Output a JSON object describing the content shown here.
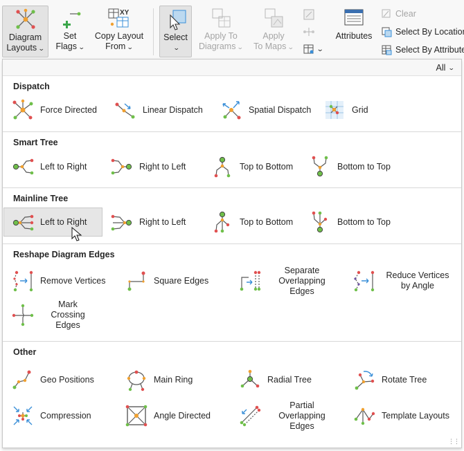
{
  "ribbon": {
    "diagram_layouts": {
      "line1": "Diagram",
      "line2": "Layouts",
      "icon": "diagram-layouts-icon"
    },
    "set_flags": {
      "line1": "Set",
      "line2": "Flags",
      "icon": "set-flags-icon"
    },
    "copy_layout": {
      "line1": "Copy Layout",
      "line2": "From",
      "icon": "copy-layout-icon"
    },
    "select": {
      "line1": "Select",
      "icon": "select-arrow-icon"
    },
    "apply_to_diagrams": {
      "line1": "Apply To",
      "line2": "Diagrams",
      "icon": "apply-to-diagrams-icon"
    },
    "apply_to_maps": {
      "line1": "Apply",
      "line2": "To Maps",
      "icon": "apply-to-maps-icon"
    },
    "attributes": {
      "label": "Attributes",
      "icon": "attributes-table-icon"
    },
    "clear": {
      "label": "Clear",
      "icon": "clear-selection-icon"
    },
    "select_by_location": {
      "label": "Select By Location",
      "icon": "select-by-location-icon"
    },
    "select_by_attributes": {
      "label": "Select By Attributes",
      "icon": "select-by-attributes-icon"
    }
  },
  "gallery": {
    "filter": {
      "selected": "All"
    },
    "sections": [
      {
        "title": "Dispatch",
        "items": [
          "Force Directed",
          "Linear Dispatch",
          "Spatial Dispatch",
          "Grid"
        ]
      },
      {
        "title": "Smart Tree",
        "items": [
          "Left to Right",
          "Right to Left",
          "Top to Bottom",
          "Bottom to Top"
        ]
      },
      {
        "title": "Mainline Tree",
        "items": [
          "Left to Right",
          "Right to Left",
          "Top to Bottom",
          "Bottom to Top"
        ]
      },
      {
        "title": "Reshape Diagram Edges",
        "items": [
          "Remove Vertices",
          "Square Edges",
          "Separate Overlapping Edges",
          "Reduce Vertices by Angle",
          "Mark Crossing Edges"
        ]
      },
      {
        "title": "Other",
        "items": [
          "Geo Positions",
          "Main Ring",
          "Radial Tree",
          "Rotate Tree",
          "Compression",
          "Angle Directed",
          "Partial Overlapping Edges",
          "Template Layouts"
        ]
      }
    ]
  },
  "colors": {
    "node_orange": "#f0a030",
    "node_green": "#6fbf4a",
    "node_red": "#e05050",
    "edge_gray": "#5a5a5a",
    "arrow_blue": "#3a8fd8"
  }
}
